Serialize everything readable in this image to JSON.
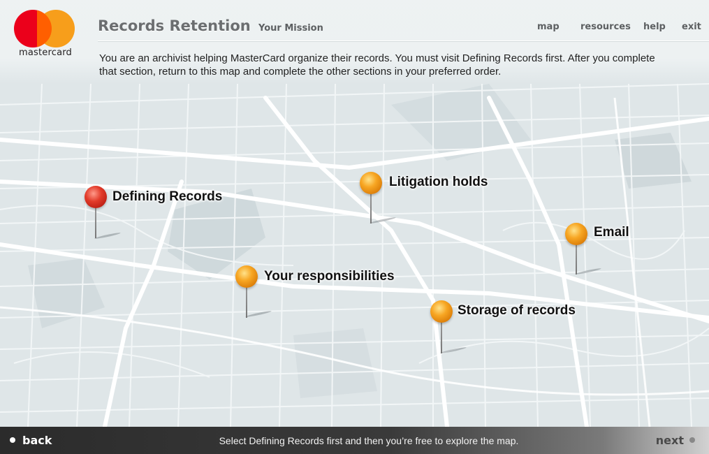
{
  "brand": {
    "logo_text": "mastercard"
  },
  "header": {
    "title": "Records Retention",
    "subtitle": "Your Mission",
    "nav": {
      "map": "map",
      "resources": "resources",
      "help": "help",
      "exit": "exit"
    }
  },
  "intro": "You are an archivist helping MasterCard organize their records. You must visit Defining Records first. After you complete that section, return to this map and complete the other sections in your preferred order.",
  "pins": {
    "defining_records": {
      "label": "Defining Records",
      "color": "red"
    },
    "litigation_holds": {
      "label": "Litigation holds",
      "color": "orange"
    },
    "email": {
      "label": "Email",
      "color": "orange"
    },
    "your_responsibilities": {
      "label": "Your responsibilities",
      "color": "orange"
    },
    "storage_of_records": {
      "label": "Storage of records",
      "color": "orange"
    }
  },
  "footer": {
    "back_label": "back",
    "message": "Select Defining Records first and then you’re free to explore the map.",
    "next_label": "next"
  },
  "colors": {
    "mc_red": "#eb001b",
    "mc_orange": "#f79e1b",
    "pin_orange": "#f7a623",
    "pin_red": "#e23b2a"
  }
}
